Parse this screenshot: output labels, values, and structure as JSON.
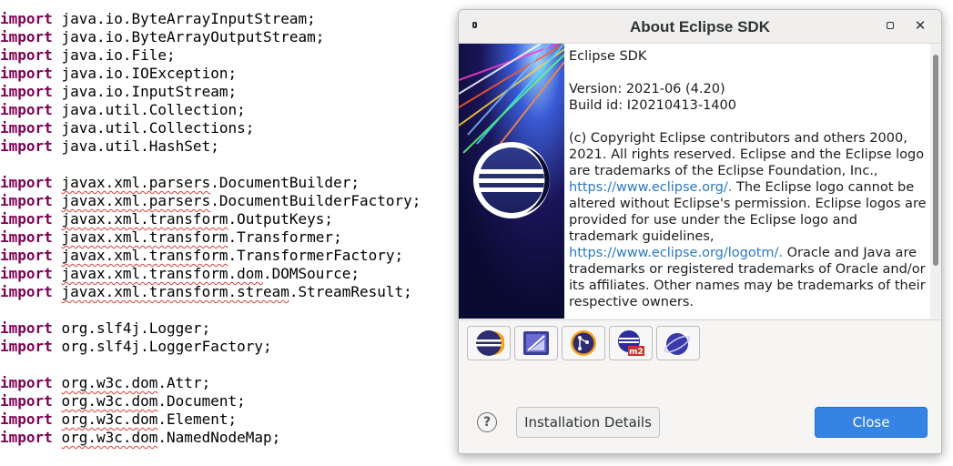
{
  "editor": {
    "lines": [
      {
        "kw": "import",
        "pre": "",
        "err": "",
        "post": "java.io.ByteArrayInputStream;"
      },
      {
        "kw": "import",
        "pre": "",
        "err": "",
        "post": "java.io.ByteArrayOutputStream;"
      },
      {
        "kw": "import",
        "pre": "",
        "err": "",
        "post": "java.io.File;"
      },
      {
        "kw": "import",
        "pre": "",
        "err": "",
        "post": "java.io.IOException;"
      },
      {
        "kw": "import",
        "pre": "",
        "err": "",
        "post": "java.io.InputStream;"
      },
      {
        "kw": "import",
        "pre": "",
        "err": "",
        "post": "java.util.Collection;"
      },
      {
        "kw": "import",
        "pre": "",
        "err": "",
        "post": "java.util.Collections;"
      },
      {
        "kw": "import",
        "pre": "",
        "err": "",
        "post": "java.util.HashSet;"
      },
      {
        "blank": true
      },
      {
        "kw": "import",
        "pre": "",
        "err": "javax.xml.parsers",
        "post": ".DocumentBuilder;"
      },
      {
        "kw": "import",
        "pre": "",
        "err": "javax.xml.parsers",
        "post": ".DocumentBuilderFactory;"
      },
      {
        "kw": "import",
        "pre": "",
        "err": "javax.xml.transform",
        "post": ".OutputKeys;"
      },
      {
        "kw": "import",
        "pre": "",
        "err": "javax.xml.transform",
        "post": ".Transformer;"
      },
      {
        "kw": "import",
        "pre": "",
        "err": "javax.xml.transform",
        "post": ".TransformerFactory;"
      },
      {
        "kw": "import",
        "pre": "",
        "err": "javax.xml.transform.dom",
        "post": ".DOMSource;"
      },
      {
        "kw": "import",
        "pre": "",
        "err": "javax.xml.transform.stream",
        "post": ".StreamResult;"
      },
      {
        "blank": true
      },
      {
        "kw": "import",
        "pre": "",
        "err": "",
        "post": "org.slf4j.Logger;"
      },
      {
        "kw": "import",
        "pre": "",
        "err": "",
        "post": "org.slf4j.LoggerFactory;"
      },
      {
        "blank": true
      },
      {
        "kw": "import",
        "pre": "",
        "err": "org.w3c.dom",
        "post": ".Attr;"
      },
      {
        "kw": "import",
        "pre": "",
        "err": "org.w3c.dom",
        "post": ".Document;"
      },
      {
        "kw": "import",
        "pre": "",
        "err": "org.w3c.dom",
        "post": ".Element;"
      },
      {
        "kw": "import",
        "pre": "",
        "err": "org.w3c.dom",
        "post": ".NamedNodeMap;"
      }
    ]
  },
  "dialog": {
    "title": "About Eclipse SDK",
    "product_name": "Eclipse SDK",
    "version": "Version: 2021-06 (4.20)",
    "build_id": "Build id: I20210413-1400",
    "copyright_1": "(c) Copyright Eclipse contributors and others 2000, 2021.  All rights reserved. Eclipse and the Eclipse logo are trademarks of the Eclipse Foundation, Inc., ",
    "link_1": "https://www.eclipse.org/.",
    "copyright_2": " The Eclipse logo cannot be altered without Eclipse's permission. Eclipse logos are provided for use under the Eclipse logo and trademark guidelines, ",
    "link_2": "https://www.eclipse.org/logotm/.",
    "copyright_3": " Oracle and Java are trademarks or registered trademarks of Oracle and/or its affiliates. Other names may be trademarks of their respective owners.",
    "features": [
      {
        "icon": "eclipse-platform-icon"
      },
      {
        "icon": "jdt-icon"
      },
      {
        "icon": "egit-icon"
      },
      {
        "icon": "m2e-icon"
      },
      {
        "icon": "pde-icon"
      }
    ],
    "feature_badge": "m2",
    "help_glyph": "?",
    "details_label": "Installation Details",
    "close_label": "Close"
  },
  "colors": {
    "keyword": "#7f0055",
    "link": "#2a78c8",
    "close_button": "#3584e4",
    "splash_bg": "#0a0b33"
  }
}
